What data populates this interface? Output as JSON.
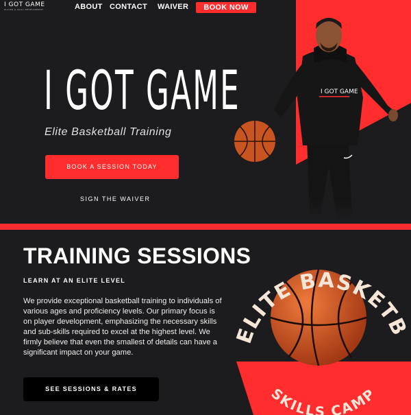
{
  "nav": {
    "logo_main": "I GOT GAME",
    "logo_sub": "PLAYER & SKILL DEVELOPMENT",
    "about": "ABOUT",
    "contact": "CONTACT",
    "waiver": "WAIVER",
    "book_now": "BOOK NOW"
  },
  "hero": {
    "title": "I GOT GAME",
    "subtitle": "Elite Basketball Training",
    "cta": "BOOK A SESSION TODAY",
    "waiver_link": "SIGN THE WAIVER",
    "hoodie_logo": "I GOT GAME"
  },
  "training": {
    "title": "TRAINING SESSIONS",
    "kicker": "LEARN AT AN ELITE LEVEL",
    "body": "We provide exceptional basketball training to individuals of various ages and proficiency levels. Our primary focus is on player development, emphasizing the necessary skills and sub-skills required to excel at the highest level. We firmly believe that even the smallest of details can have a significant impact on your game.",
    "cta": "SEE SESSIONS & RATES"
  },
  "camp": {
    "arc_top": "ELITE BASKETBALL",
    "arc_bottom": "SKILLS CAMP"
  },
  "colors": {
    "accent_red": "#ff2d2d",
    "background": "#1c1b1d",
    "camp_text": "#f6e6d8",
    "ball_orange": "#d9581f"
  }
}
